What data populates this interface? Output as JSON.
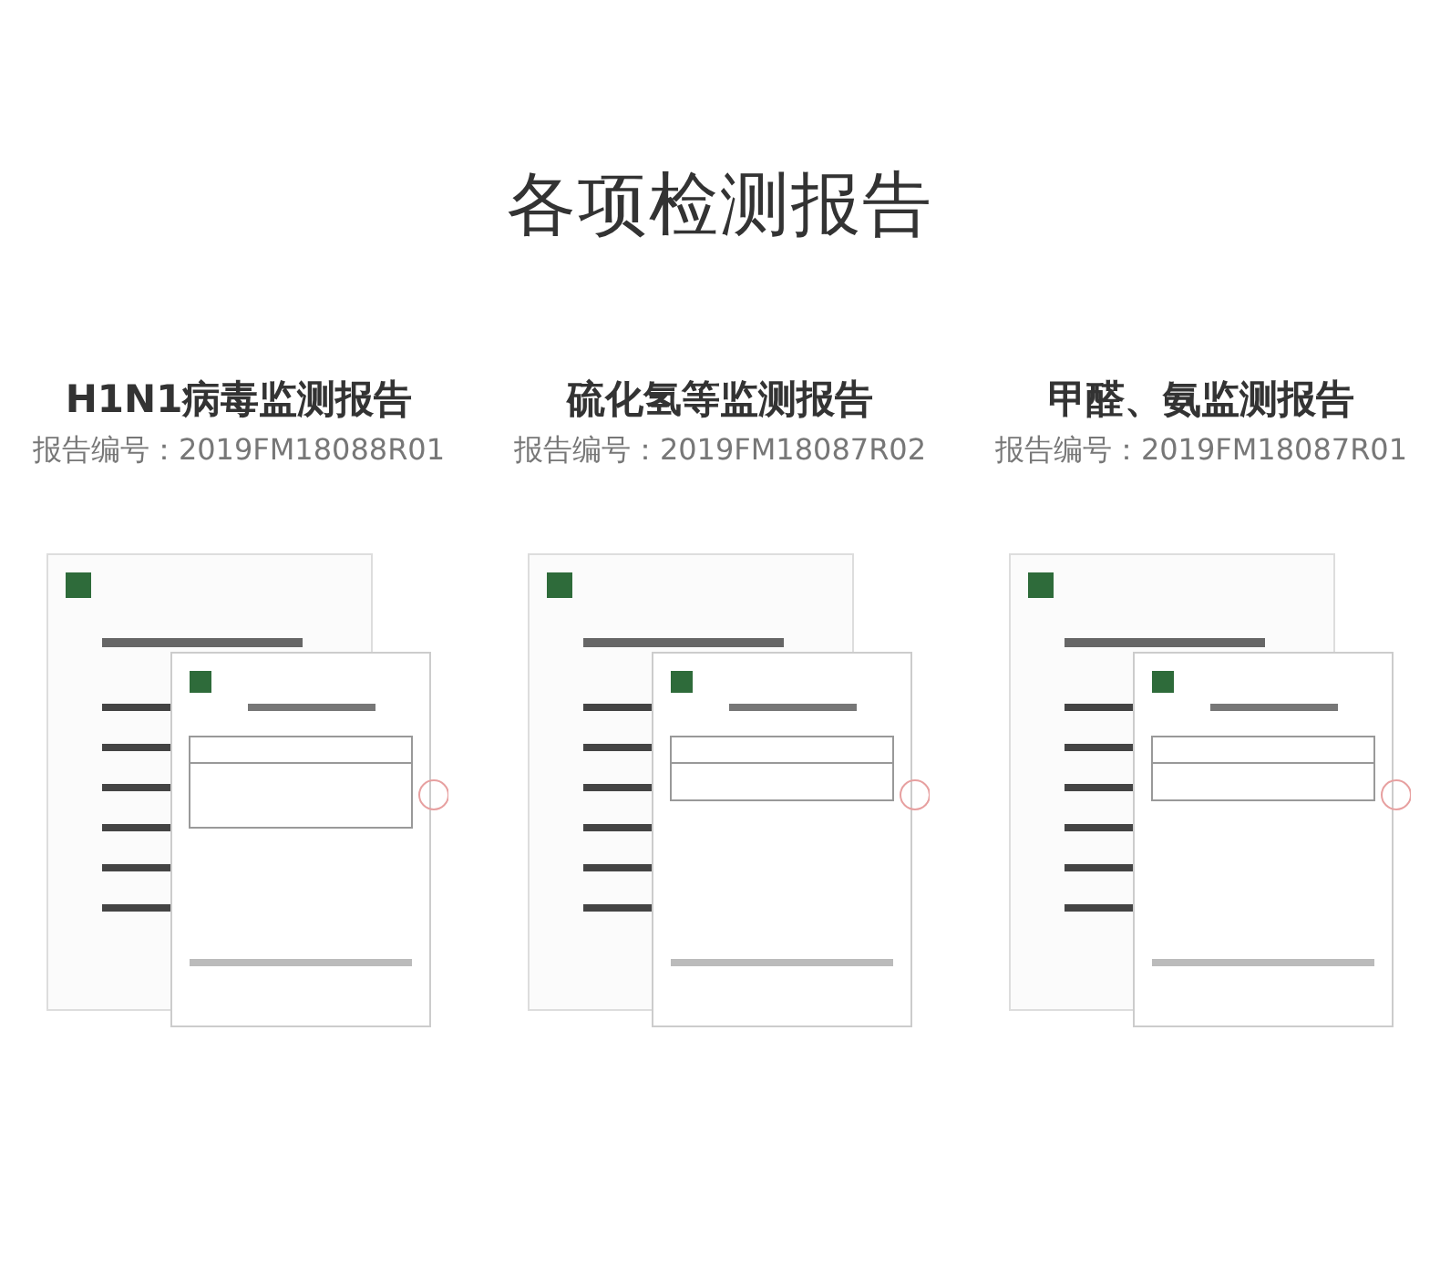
{
  "title": "各项检测报告",
  "reports": [
    {
      "name": "H1N1病毒监测报告",
      "number": "报告编号：2019FM18088R01",
      "kind": "picture"
    },
    {
      "name": "硫化氢等监测报告",
      "number": "报告编号：2019FM18087R02",
      "kind": "picture"
    },
    {
      "name": "甲醛、氨监测报告",
      "number": "报告编号：2019FM18087R01",
      "kind": "picture"
    }
  ]
}
